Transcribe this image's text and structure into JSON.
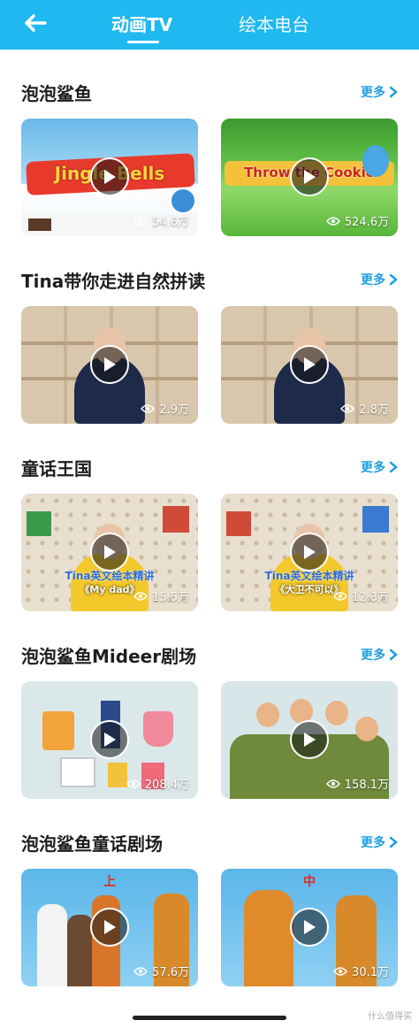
{
  "header": {
    "tabs": [
      {
        "label": "动画TV"
      },
      {
        "label": "绘本电台"
      }
    ]
  },
  "more_label": "更多",
  "sections": [
    {
      "title": "泡泡鲨鱼",
      "videos": [
        {
          "views": "54.6万",
          "caption": "Jingle Bells"
        },
        {
          "views": "524.6万",
          "caption": "Throw the Cookie"
        }
      ]
    },
    {
      "title": "Tina带你走进自然拼读",
      "videos": [
        {
          "views": "2.9万"
        },
        {
          "views": "2.8万"
        }
      ]
    },
    {
      "title": "童话王国",
      "videos": [
        {
          "views": "15.5万",
          "caption": "Tina英文绘本精讲",
          "sub": "《My dad》"
        },
        {
          "views": "12.3万",
          "caption": "Tina英文绘本精讲",
          "sub": "《大卫不可以》"
        }
      ]
    },
    {
      "title": "泡泡鲨鱼Mideer剧场",
      "videos": [
        {
          "views": "208.4万"
        },
        {
          "views": "158.1万"
        }
      ]
    },
    {
      "title": "泡泡鲨鱼童话剧场",
      "videos": [
        {
          "views": "57.6万",
          "caption": "上"
        },
        {
          "views": "30.1万",
          "caption": "中"
        }
      ]
    }
  ],
  "watermark": "什么值得买"
}
